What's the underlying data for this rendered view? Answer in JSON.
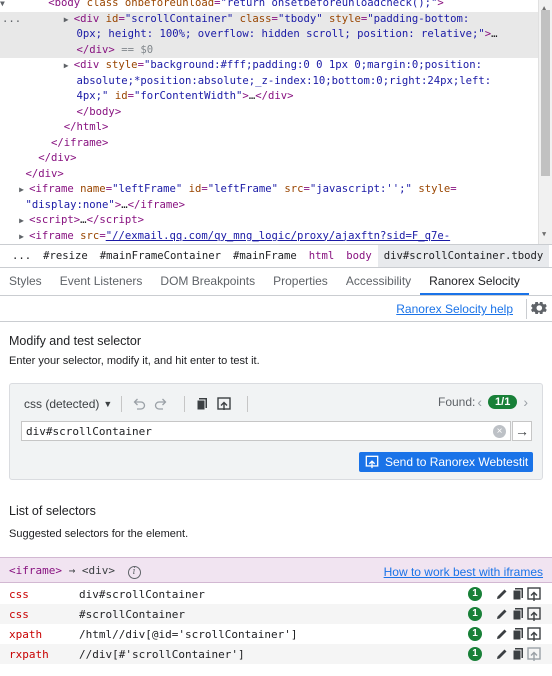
{
  "elements_tree": {
    "rows": [
      {
        "indent": "        ",
        "html": "&lt;body class onbeforeunload=\"return onsetbeforeunloadcheck();\"&gt;"
      },
      {
        "indent": "          ",
        "html": "&lt;div id=\"scrollContainer\" class=\"tbody\" style=\"padding-bottom:"
      },
      {
        "indent": "        ",
        "html": "0px; height: 100%; overflow: hidden scroll; position: relative;\"&gt;…"
      },
      {
        "indent": "        ",
        "html": "&lt;/div&gt; == $0"
      },
      {
        "indent": "          ",
        "html": "&lt;div style=\"background:#fff;padding:0 0 1px 0;margin:0;position:"
      },
      {
        "indent": "        ",
        "html": "absolute;*position:absolute;_z-index:10;bottom:0;right:24px;left:"
      },
      {
        "indent": "        ",
        "html": "4px;\" id=\"forContentWidth\"&gt;…&lt;/div&gt;"
      },
      {
        "indent": "          ",
        "html": "&lt;/body&gt;"
      },
      {
        "indent": "        ",
        "html": "&lt;/html&gt;"
      },
      {
        "indent": "      ",
        "html": "&lt;/iframe&gt;"
      },
      {
        "indent": "    ",
        "html": "&lt;/div&gt;"
      },
      {
        "indent": "  ",
        "html": "&lt;/div&gt;"
      },
      {
        "indent": "",
        "html": "&lt;iframe name=\"leftFrame\" id=\"leftFrame\" src=\"javascript:'';\" style="
      },
      {
        "indent": "",
        "html": "\"display:none\"&gt;…&lt;/iframe&gt;"
      },
      {
        "indent": "",
        "html": "&lt;script&gt;…&lt;/script&gt;"
      },
      {
        "indent": "",
        "html": "&lt;iframe src=\"//exmail.qq.com/qy_mng_logic/proxy/ajaxftn?sid=F_q7e-"
      }
    ]
  },
  "breadcrumb": {
    "ellipsis": "...",
    "items": [
      "#resize",
      "#mainFrameContainer",
      "#mainFrame",
      "html",
      "body",
      "div#scrollContainer.tbody"
    ]
  },
  "tabs": [
    "Styles",
    "Event Listeners",
    "DOM Breakpoints",
    "Properties",
    "Accessibility",
    "Ranorex Selocity"
  ],
  "help_link": "Ranorex Selocity help",
  "modify": {
    "title": "Modify and test selector",
    "subtitle": "Enter your selector, modify it, and hit enter to test it.",
    "selector_type": "css (detected)",
    "found_label": "Found:",
    "found_value": "1/1",
    "selector_value": "div#scrollContainer",
    "send_button": "Send to Ranorex Webtestit"
  },
  "list": {
    "title": "List of selectors",
    "subtitle": "Suggested selectors for the element.",
    "iframe_path_tag": "<iframe>",
    "iframe_path_arrow": "→",
    "iframe_path_rest": "<div>",
    "info_glyph": "i",
    "how_link": "How to work best with iframes",
    "rows": [
      {
        "type": "css",
        "value": "div#scrollContainer",
        "count": "1"
      },
      {
        "type": "css",
        "value": "#scrollContainer",
        "count": "1"
      },
      {
        "type": "xpath",
        "value": "/html//div[@id='scrollContainer']",
        "count": "1"
      },
      {
        "type": "rxpath",
        "value": "//div[#'scrollContainer']",
        "count": "1"
      }
    ]
  },
  "colors": {
    "accent": "#1a73e8",
    "success": "#188038",
    "tag": "#881280",
    "type": "#c80000"
  },
  "icons": [
    "undo-icon",
    "redo-icon",
    "copy-icon",
    "send-icon",
    "gear-icon",
    "clear-icon",
    "arrow-right-icon",
    "edit-icon",
    "info-icon"
  ]
}
